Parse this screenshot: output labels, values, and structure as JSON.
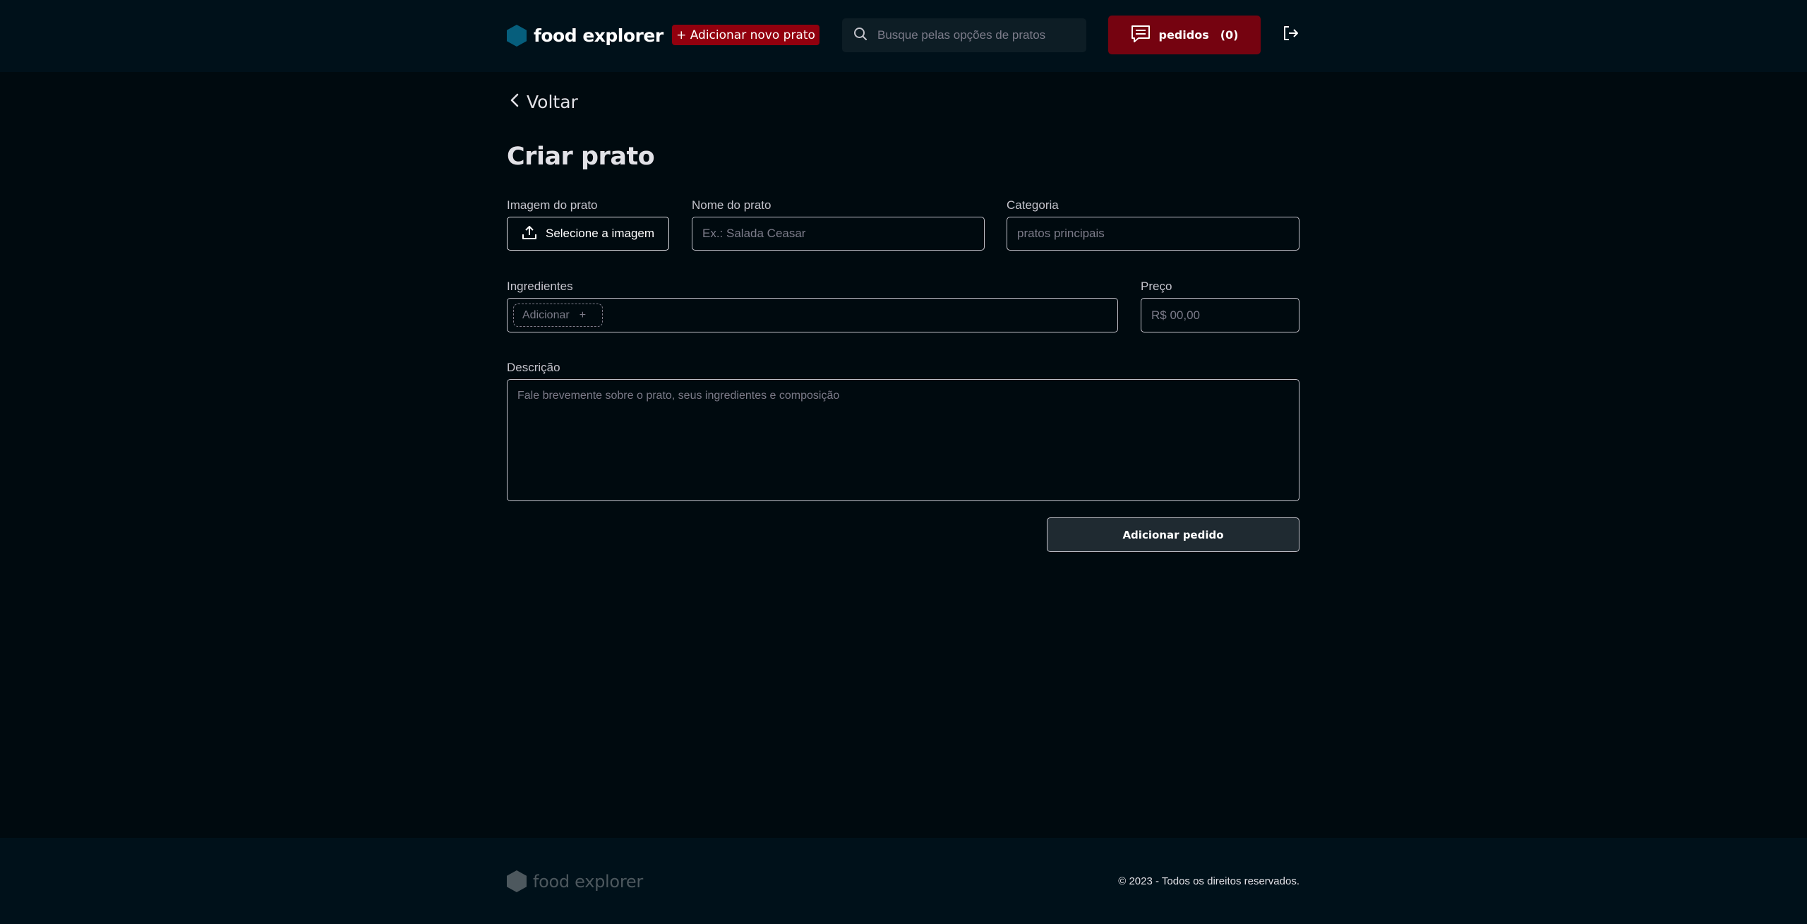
{
  "header": {
    "brand": "food explorer",
    "new_dish_label": "+ Adicionar novo prato",
    "search_placeholder": "Busque pelas opções de pratos",
    "orders_label": "pedidos",
    "orders_count": "(0)",
    "icons": {
      "logo": "hexagon-logo-icon",
      "search": "search-icon",
      "orders": "receipt-icon",
      "logout": "sign-out-icon"
    }
  },
  "main": {
    "back_label": "Voltar",
    "title": "Criar prato",
    "image": {
      "label": "Imagem do prato",
      "button": "Selecione a imagem"
    },
    "name": {
      "label": "Nome do prato",
      "placeholder": "Ex.: Salada Ceasar"
    },
    "category": {
      "label": "Categoria",
      "placeholder": "pratos principais"
    },
    "ingredients": {
      "label": "Ingredientes",
      "new_tag": "Adicionar",
      "add_symbol": "+"
    },
    "price": {
      "label": "Preço",
      "placeholder": "R$ 00,00"
    },
    "description": {
      "label": "Descrição",
      "placeholder": "Fale brevemente sobre o prato, seus ingredientes e composição"
    },
    "submit_label": "Adicionar pedido"
  },
  "footer": {
    "brand": "food explorer",
    "copyright": "© 2023 - Todos os direitos reservados."
  },
  "colors": {
    "background": "#000a0f",
    "header_bg": "#00111a",
    "accent_red": "#92000e",
    "orders_red": "#750310",
    "logo_blue": "#065e7c",
    "footer_logo": "#4d585e"
  }
}
